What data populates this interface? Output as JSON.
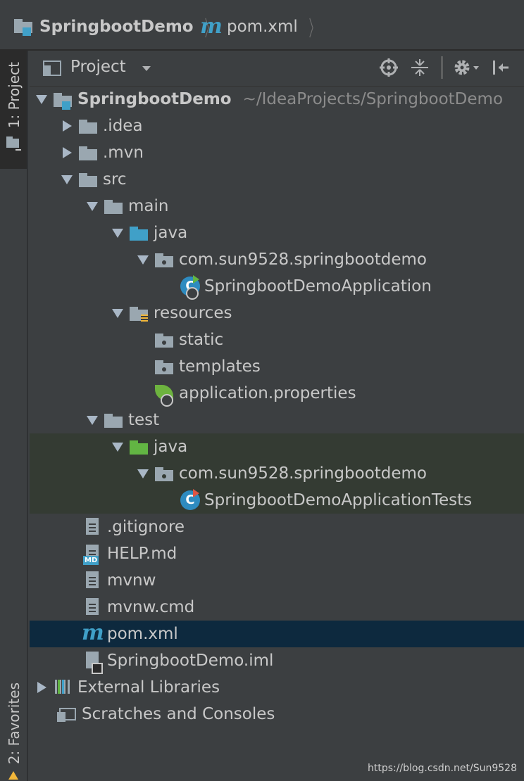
{
  "nav": {
    "project": "SpringbootDemo",
    "file": "pom.xml"
  },
  "left_stripe": {
    "project_tab": "1: Project",
    "favorites_tab": "2: Favorites"
  },
  "panel": {
    "title": "Project",
    "icons": [
      "target-icon",
      "collapse-icon",
      "gear-icon",
      "hide-icon"
    ]
  },
  "tree": {
    "root": {
      "label": "SpringbootDemo",
      "path": "~/IdeaProjects/SpringbootDemo"
    },
    "items": [
      {
        "label": ".idea"
      },
      {
        "label": ".mvn"
      },
      {
        "label": "src"
      },
      {
        "label": "main"
      },
      {
        "label": "java"
      },
      {
        "label": "com.sun9528.springbootdemo"
      },
      {
        "label": "SpringbootDemoApplication"
      },
      {
        "label": "resources"
      },
      {
        "label": "static"
      },
      {
        "label": "templates"
      },
      {
        "label": "application.properties"
      },
      {
        "label": "test"
      },
      {
        "label": "java"
      },
      {
        "label": "com.sun9528.springbootdemo"
      },
      {
        "label": "SpringbootDemoApplicationTests"
      },
      {
        "label": ".gitignore"
      },
      {
        "label": "HELP.md"
      },
      {
        "label": "mvnw"
      },
      {
        "label": "mvnw.cmd"
      },
      {
        "label": "pom.xml"
      },
      {
        "label": "SpringbootDemo.iml"
      },
      {
        "label": "External Libraries"
      },
      {
        "label": "Scratches and Consoles"
      }
    ]
  },
  "watermark": "https://blog.csdn.net/Sun9528",
  "colors": {
    "background": "#3c3f41",
    "selection": "#0d293e",
    "test_highlight": "#343b33",
    "accent_blue": "#40a0c8",
    "accent_green": "#62b543"
  }
}
